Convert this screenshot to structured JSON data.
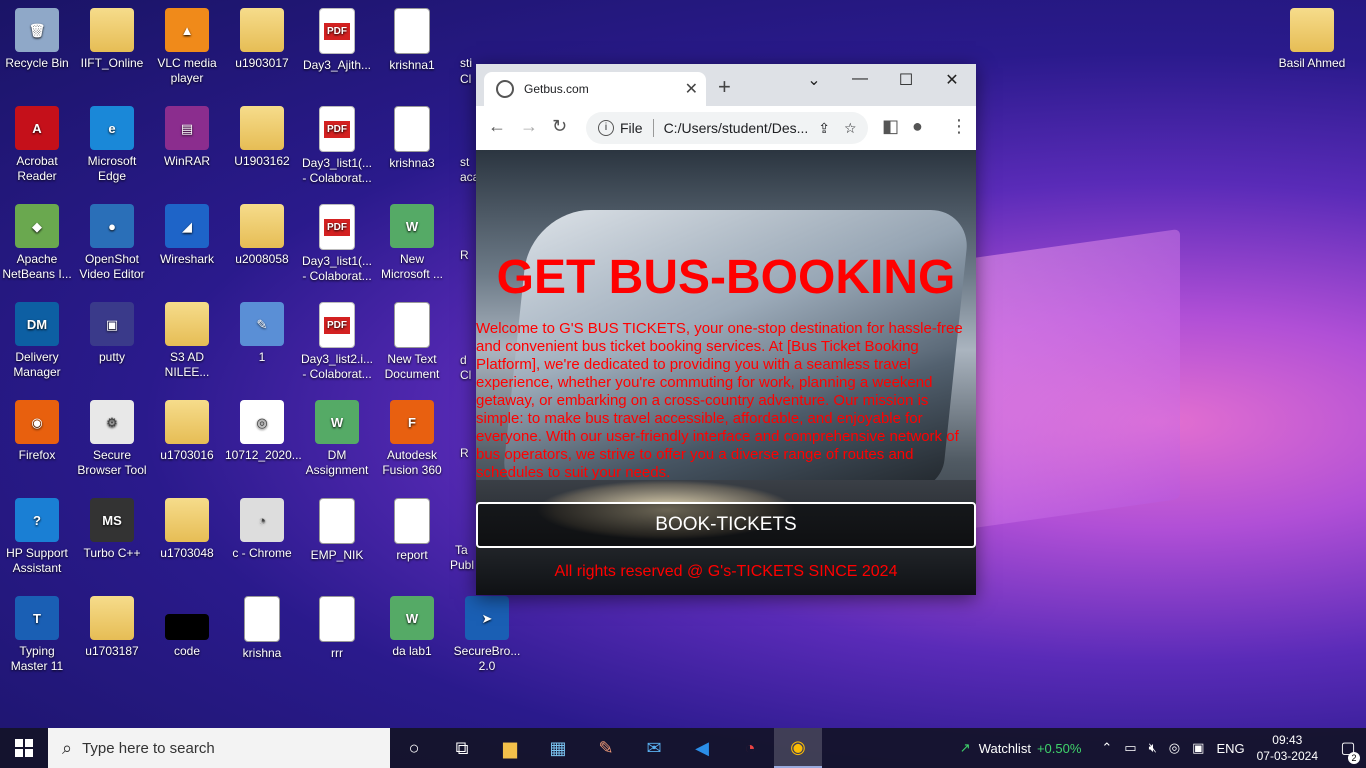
{
  "desktop": {
    "icons": [
      {
        "label": "Recycle Bin",
        "glyph": "🗑"
      },
      {
        "label": "IIFT_Online",
        "glyph": ""
      },
      {
        "label": "VLC media player",
        "glyph": "▲"
      },
      {
        "label": "u1903017",
        "glyph": ""
      },
      {
        "label": "Day3_Ajith...",
        "glyph": "PDF"
      },
      {
        "label": "krishna1",
        "glyph": ""
      },
      {
        "label": "Acrobat Reader",
        "glyph": "A"
      },
      {
        "label": "Microsoft Edge",
        "glyph": "e"
      },
      {
        "label": "WinRAR",
        "glyph": "▤"
      },
      {
        "label": "U1903162",
        "glyph": ""
      },
      {
        "label": "Day3_list1(... - Colaborat...",
        "glyph": "PDF"
      },
      {
        "label": "krishna3",
        "glyph": ""
      },
      {
        "label": "Apache NetBeans I...",
        "glyph": "◆"
      },
      {
        "label": "OpenShot Video Editor",
        "glyph": "●"
      },
      {
        "label": "Wireshark",
        "glyph": "◢"
      },
      {
        "label": "u2008058",
        "glyph": ""
      },
      {
        "label": "Day3_list1(... - Colaborat...",
        "glyph": "PDF"
      },
      {
        "label": "New Microsoft ...",
        "glyph": "W"
      },
      {
        "label": "Delivery Manager",
        "glyph": "DM"
      },
      {
        "label": "putty",
        "glyph": "▣"
      },
      {
        "label": "S3 AD NILEE...",
        "glyph": ""
      },
      {
        "label": "1",
        "glyph": "✎"
      },
      {
        "label": "Day3_list2.i... - Colaborat...",
        "glyph": "PDF"
      },
      {
        "label": "New Text Document",
        "glyph": ""
      },
      {
        "label": "Firefox",
        "glyph": "◉"
      },
      {
        "label": "Secure Browser Tool",
        "glyph": "⚙"
      },
      {
        "label": "u1703016",
        "glyph": ""
      },
      {
        "label": "10712_2020...",
        "glyph": "◎"
      },
      {
        "label": "DM Assignment",
        "glyph": "W"
      },
      {
        "label": "Autodesk Fusion 360",
        "glyph": "F"
      },
      {
        "label": "HP Support Assistant",
        "glyph": "?"
      },
      {
        "label": "Turbo C++",
        "glyph": "MS"
      },
      {
        "label": "u1703048",
        "glyph": ""
      },
      {
        "label": "c - Chrome",
        "glyph": "◔"
      },
      {
        "label": "EMP_NIK",
        "glyph": ""
      },
      {
        "label": "report",
        "glyph": ""
      },
      {
        "label": "Typing Master 11",
        "glyph": "T"
      },
      {
        "label": "u1703187",
        "glyph": ""
      },
      {
        "label": "code",
        "glyph": ""
      },
      {
        "label": "krishna",
        "glyph": ""
      },
      {
        "label": "rrr",
        "glyph": ""
      },
      {
        "label": "da lab1",
        "glyph": "W"
      },
      {
        "label": "SecureBro... 2.0",
        "glyph": "➤"
      },
      {
        "label": "Basil Ahmed",
        "glyph": ""
      }
    ],
    "partial_labels": [
      "sti",
      "Cl",
      "st",
      "aca",
      "R",
      "d",
      "Cl",
      "R",
      "Ta",
      "Publ"
    ]
  },
  "browser": {
    "tab_title": "Getbus.com",
    "address_scheme": "File",
    "address_url": "C:/Users/student/Des...",
    "page": {
      "heading": "GET BUS-BOOKING",
      "paragraph": "Welcome to G'S BUS TICKETS, your one-stop destination for hassle-free and convenient bus ticket booking services. At [Bus Ticket Booking Platform], we're dedicated to providing you with a seamless travel experience, whether you're commuting for work, planning a weekend getaway, or embarking on a cross-country adventure. Our mission is simple: to make bus travel accessible, affordable, and enjoyable for everyone. With our user-friendly interface and comprehensive network of bus operators, we strive to offer you a diverse range of routes and schedules to suit your needs.",
      "button_label": "BOOK-TICKETS",
      "footer": "All rights reserved @ G's-TICKETS SINCE 2024"
    }
  },
  "taskbar": {
    "search_placeholder": "Type here to search",
    "watchlist_label": "Watchlist",
    "watchlist_change": "+0.50%",
    "language": "ENG",
    "time": "09:43",
    "date": "07-03-2024",
    "notification_count": "2"
  },
  "colors": {
    "accent_red": "#ff0000",
    "watch_green": "#3fd36b"
  }
}
